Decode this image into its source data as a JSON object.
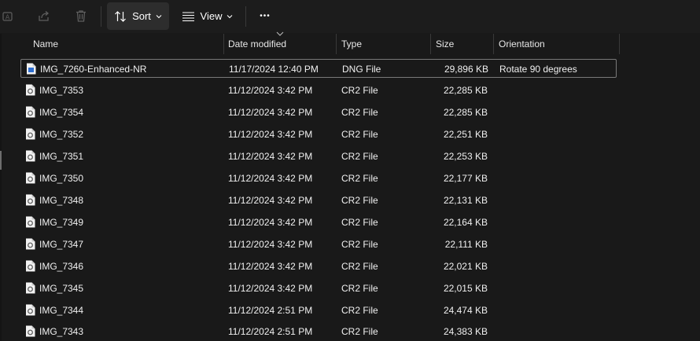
{
  "toolbar": {
    "sort_label": "Sort",
    "view_label": "View",
    "more_label": "•••"
  },
  "columns": [
    {
      "label": "Name"
    },
    {
      "label": "Date modified"
    },
    {
      "label": "Type"
    },
    {
      "label": "Size"
    },
    {
      "label": "Orientation"
    }
  ],
  "files": [
    {
      "name": "IMG_7260-Enhanced-NR",
      "date": "11/17/2024 12:40 PM",
      "type": "DNG File",
      "size": "29,896 KB",
      "orientation": "Rotate 90 degrees",
      "icon": "dng-file-icon"
    },
    {
      "name": "IMG_7353",
      "date": "11/12/2024 3:42 PM",
      "type": "CR2 File",
      "size": "22,285 KB",
      "orientation": "",
      "icon": "cr2-file-icon"
    },
    {
      "name": "IMG_7354",
      "date": "11/12/2024 3:42 PM",
      "type": "CR2 File",
      "size": "22,285 KB",
      "orientation": "",
      "icon": "cr2-file-icon"
    },
    {
      "name": "IMG_7352",
      "date": "11/12/2024 3:42 PM",
      "type": "CR2 File",
      "size": "22,251 KB",
      "orientation": "",
      "icon": "cr2-file-icon"
    },
    {
      "name": "IMG_7351",
      "date": "11/12/2024 3:42 PM",
      "type": "CR2 File",
      "size": "22,253 KB",
      "orientation": "",
      "icon": "cr2-file-icon"
    },
    {
      "name": "IMG_7350",
      "date": "11/12/2024 3:42 PM",
      "type": "CR2 File",
      "size": "22,177 KB",
      "orientation": "",
      "icon": "cr2-file-icon"
    },
    {
      "name": "IMG_7348",
      "date": "11/12/2024 3:42 PM",
      "type": "CR2 File",
      "size": "22,131 KB",
      "orientation": "",
      "icon": "cr2-file-icon"
    },
    {
      "name": "IMG_7349",
      "date": "11/12/2024 3:42 PM",
      "type": "CR2 File",
      "size": "22,164 KB",
      "orientation": "",
      "icon": "cr2-file-icon"
    },
    {
      "name": "IMG_7347",
      "date": "11/12/2024 3:42 PM",
      "type": "CR2 File",
      "size": "22,111 KB",
      "orientation": "",
      "icon": "cr2-file-icon"
    },
    {
      "name": "IMG_7346",
      "date": "11/12/2024 3:42 PM",
      "type": "CR2 File",
      "size": "22,021 KB",
      "orientation": "",
      "icon": "cr2-file-icon"
    },
    {
      "name": "IMG_7345",
      "date": "11/12/2024 3:42 PM",
      "type": "CR2 File",
      "size": "22,015 KB",
      "orientation": "",
      "icon": "cr2-file-icon"
    },
    {
      "name": "IMG_7344",
      "date": "11/12/2024 2:51 PM",
      "type": "CR2 File",
      "size": "24,474 KB",
      "orientation": "",
      "icon": "cr2-file-icon"
    },
    {
      "name": "IMG_7343",
      "date": "11/12/2024 2:51 PM",
      "type": "CR2 File",
      "size": "24,383 KB",
      "orientation": "",
      "icon": "cr2-file-icon"
    }
  ],
  "colors": {
    "background": "#191919",
    "selected_border": "#797979",
    "disabled_icon": "#5e5e5e"
  }
}
